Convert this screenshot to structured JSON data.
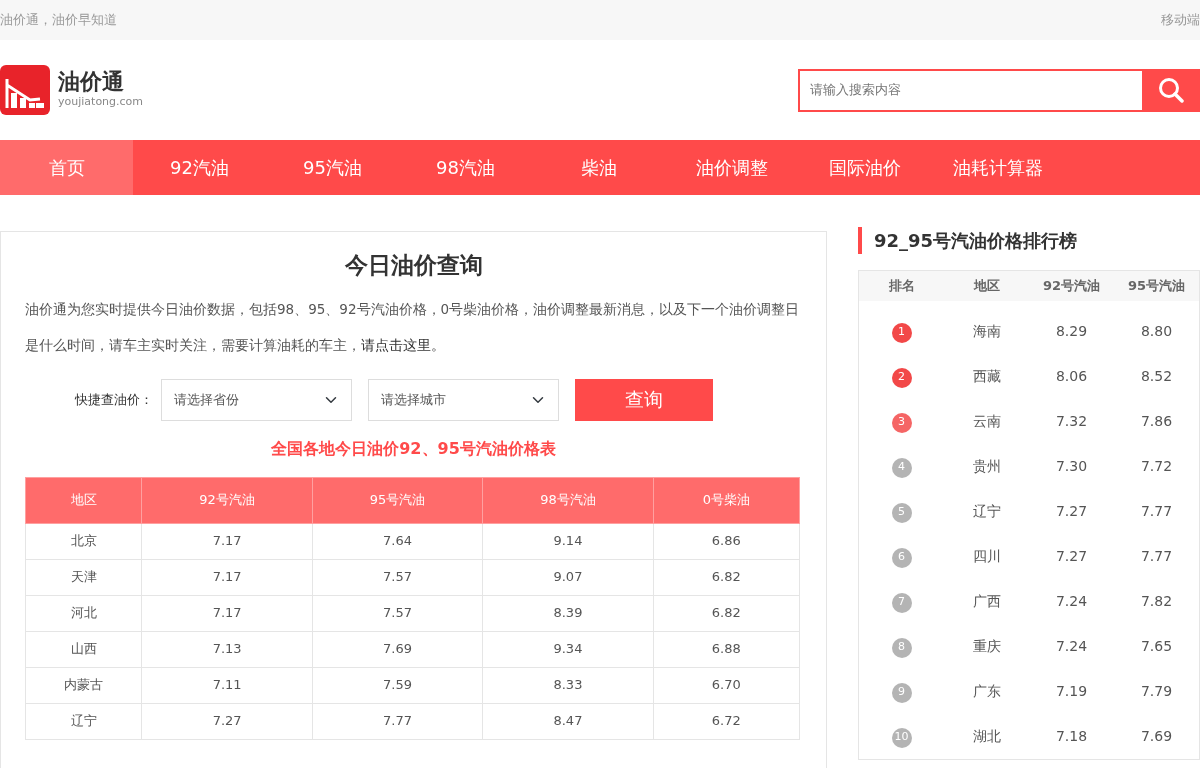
{
  "topbar": {
    "slogan": "油价通，油价早知道",
    "mobile_link": "移动端"
  },
  "logo": {
    "name": "油价通",
    "domain": "youjiatong.com"
  },
  "search": {
    "placeholder": "请输入搜索内容"
  },
  "nav": [
    {
      "label": "首页",
      "selected": true
    },
    {
      "label": "92汽油",
      "selected": false
    },
    {
      "label": "95汽油",
      "selected": false
    },
    {
      "label": "98汽油",
      "selected": false
    },
    {
      "label": "柴油",
      "selected": false
    },
    {
      "label": "油价调整",
      "selected": false
    },
    {
      "label": "国际油价",
      "selected": false
    },
    {
      "label": "油耗计算器",
      "selected": false
    }
  ],
  "query_panel": {
    "title": "今日油价查询",
    "intro": "油价通为您实时提供今日油价数据，包括98、95、92号汽油价格，0号柴油价格，油价调整最新消息，以及下一个油价调整日是什么时间，请车主实时关注，需要计算油耗的车主，",
    "intro_link": "请点击这里。",
    "quick_label": "快捷查油价：",
    "province_placeholder": "请选择省份",
    "city_placeholder": "请选择城市",
    "query_button": "查询",
    "table_title": "全国各地今日油价92、95号汽油价格表",
    "table": {
      "columns": [
        "地区",
        "92号汽油",
        "95号汽油",
        "98号汽油",
        "0号柴油"
      ],
      "rows": [
        [
          "北京",
          "7.17",
          "7.64",
          "9.14",
          "6.86"
        ],
        [
          "天津",
          "7.17",
          "7.57",
          "9.07",
          "6.82"
        ],
        [
          "河北",
          "7.17",
          "7.57",
          "8.39",
          "6.82"
        ],
        [
          "山西",
          "7.13",
          "7.69",
          "9.34",
          "6.88"
        ],
        [
          "内蒙古",
          "7.11",
          "7.59",
          "8.33",
          "6.70"
        ],
        [
          "辽宁",
          "7.27",
          "7.77",
          "8.47",
          "6.72"
        ]
      ]
    }
  },
  "ranking": {
    "title": "92_95号汽油价格排行榜",
    "columns": [
      "排名",
      "地区",
      "92号汽油",
      "95号汽油"
    ],
    "rows": [
      {
        "rank": "1",
        "color": "#f24848",
        "region": "海南",
        "p92": "8.29",
        "p95": "8.80"
      },
      {
        "rank": "2",
        "color": "#f24848",
        "region": "西藏",
        "p92": "8.06",
        "p95": "8.52"
      },
      {
        "rank": "3",
        "color": "#f56565",
        "region": "云南",
        "p92": "7.32",
        "p95": "7.86"
      },
      {
        "rank": "4",
        "color": "#b4b4b4",
        "region": "贵州",
        "p92": "7.30",
        "p95": "7.72"
      },
      {
        "rank": "5",
        "color": "#b4b4b4",
        "region": "辽宁",
        "p92": "7.27",
        "p95": "7.77"
      },
      {
        "rank": "6",
        "color": "#b4b4b4",
        "region": "四川",
        "p92": "7.27",
        "p95": "7.77"
      },
      {
        "rank": "7",
        "color": "#b4b4b4",
        "region": "广西",
        "p92": "7.24",
        "p95": "7.82"
      },
      {
        "rank": "8",
        "color": "#b4b4b4",
        "region": "重庆",
        "p92": "7.24",
        "p95": "7.65"
      },
      {
        "rank": "9",
        "color": "#b4b4b4",
        "region": "广东",
        "p92": "7.19",
        "p95": "7.79"
      },
      {
        "rank": "10",
        "color": "#b4b4b4",
        "region": "湖北",
        "p92": "7.18",
        "p95": "7.69"
      }
    ]
  }
}
